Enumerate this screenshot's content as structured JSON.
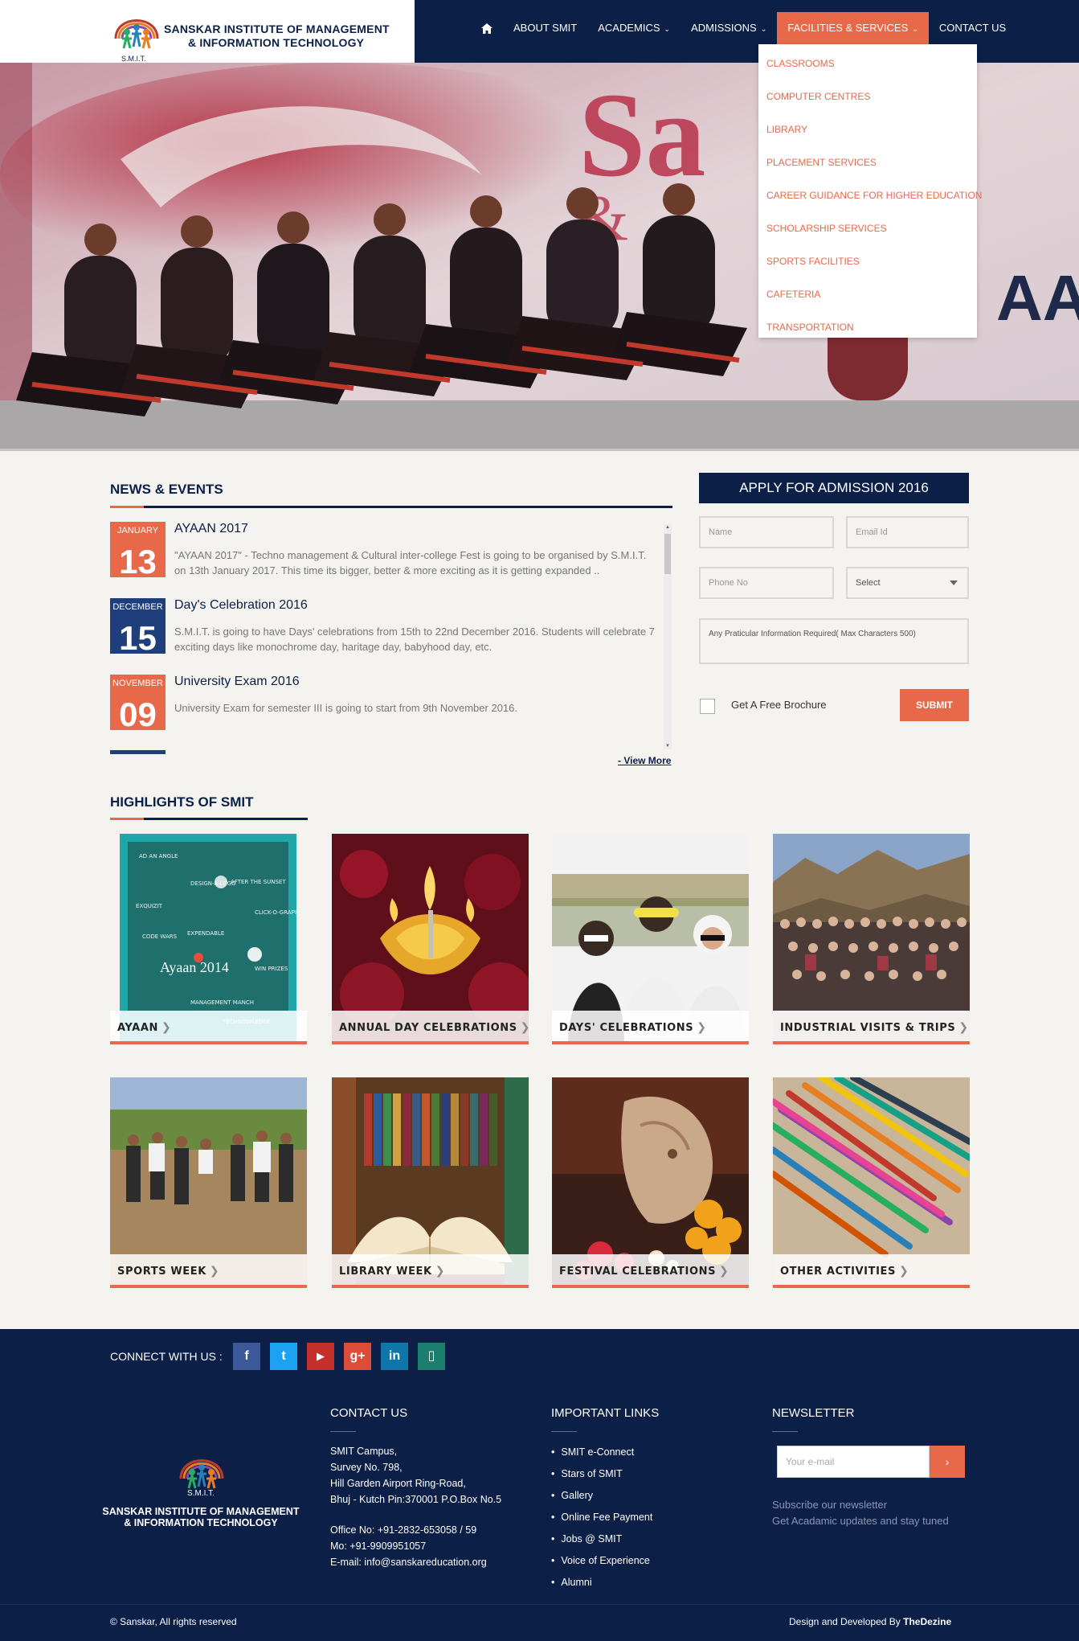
{
  "header": {
    "logo_line1": "SANSKAR INSTITUTE OF MANAGEMENT",
    "logo_line2": "& INFORMATION TECHNOLOGY",
    "logo_smit": "S.M.I.T.",
    "nav": [
      {
        "label": "ABOUT SMIT"
      },
      {
        "label": "ACADEMICS"
      },
      {
        "label": "ADMISSIONS"
      },
      {
        "label": "FACILITIES & SERVICES"
      },
      {
        "label": "CONTACT US"
      }
    ],
    "dropdown": [
      "CLASSROOMS",
      "COMPUTER CENTRES",
      "LIBRARY",
      "PLACEMENT SERVICES",
      "CAREER GUIDANCE FOR HIGHER EDUCATION",
      "SCHOLARSHIP SERVICES",
      "SPORTS FACILITIES",
      "CAFETERIA",
      "TRANSPORTATION"
    ]
  },
  "news": {
    "title": "NEWS & EVENTS",
    "items": [
      {
        "month": "JANUARY",
        "day": "13",
        "title": "AYAAN 2017",
        "text": "\"AYAAN 2017\" - Techno management & Cultural inter-college Fest is going to be organised by S.M.I.T. on 13th January 2017. This time its bigger, better & more exciting as it is getting expanded ..",
        "color": "#e8694a"
      },
      {
        "month": "DECEMBER",
        "day": "15",
        "title": "Day's Celebration 2016",
        "text": "S.M.I.T. is going to have Days' celebrations from 15th to 22nd December 2016. Students will celebrate 7 exciting days like monochrome day, haritage day, babyhood day, etc.",
        "color": "#1f3e7c"
      },
      {
        "month": "NOVEMBER",
        "day": "09",
        "title": "University Exam 2016",
        "text": "University Exam for semester III is going to start from 9th November 2016.",
        "color": "#e8694a"
      }
    ],
    "view_more": "- View More"
  },
  "admission": {
    "title": "APPLY FOR ADMISSION 2016",
    "name_placeholder": "Name",
    "email_placeholder": "Email Id",
    "phone_placeholder": "Phone No",
    "select_value": "Select",
    "info_placeholder": "Any Praticular Information Required( Max Characters 500)",
    "brochure_label": "Get A Free Brochure",
    "submit_label": "SUBMIT"
  },
  "highlights": {
    "title": "HIGHLIGHTS OF SMIT",
    "items": [
      {
        "label": "AYAAN"
      },
      {
        "label": "ANNUAL DAY CELEBRATIONS"
      },
      {
        "label": "DAYS' CELEBRATIONS"
      },
      {
        "label": "INDUSTRIAL VISITS & TRIPS"
      },
      {
        "label": "SPORTS WEEK"
      },
      {
        "label": "LIBRARY WEEK"
      },
      {
        "label": "FESTIVAL CELEBRATIONS"
      },
      {
        "label": "OTHER ACTIVITIES"
      }
    ]
  },
  "footer": {
    "connect": "CONNECT WITH US :",
    "social": [
      {
        "icon": "facebook-icon",
        "glyph": "f",
        "color": "#3b5998"
      },
      {
        "icon": "twitter-icon",
        "glyph": "t",
        "color": "#1da1f2"
      },
      {
        "icon": "youtube-icon",
        "glyph": "▶",
        "color": "#c4302b"
      },
      {
        "icon": "google-plus-icon",
        "glyph": "g+",
        "color": "#dd4b39"
      },
      {
        "icon": "linkedin-icon",
        "glyph": "in",
        "color": "#0e76a8"
      },
      {
        "icon": "mobile-icon",
        "glyph": "▯",
        "color": "#1c7f6e"
      }
    ],
    "logo_smit": "S.M.I.T.",
    "logo_line1": "SANSKAR INSTITUTE OF MANAGEMENT",
    "logo_line2": "& INFORMATION TECHNOLOGY",
    "contact_heading": "CONTACT US",
    "contact_lines": [
      "SMIT Campus,",
      "Survey No. 798,",
      "Hill Garden Airport Ring-Road,",
      "Bhuj - Kutch Pin:370001 P.O.Box No.5"
    ],
    "office": "Office No: +91-2832-653058 / 59",
    "mobile": "Mo: +91-9909951057",
    "email": "E-mail: info@sanskareducation.org",
    "links_heading": "IMPORTANT LINKS",
    "links": [
      "SMIT e-Connect",
      "Stars of SMIT",
      "Gallery",
      "Online Fee Payment",
      "Jobs @ SMIT",
      "Voice of Experience",
      "Alumni"
    ],
    "newsletter_heading": "NEWSLETTER",
    "newsletter_placeholder": "Your e-mail",
    "newsletter_btn": "›",
    "newsletter_text1": "Subscribe our newsletter",
    "newsletter_text2": "Get Acadamic updates and stay tuned",
    "copyright": "© Sanskar, All rights reserved",
    "designed_by": "Design and Developed By",
    "designer": "TheDezine"
  },
  "colors": {
    "navy": "#0c1f47",
    "accent": "#e8694a"
  }
}
